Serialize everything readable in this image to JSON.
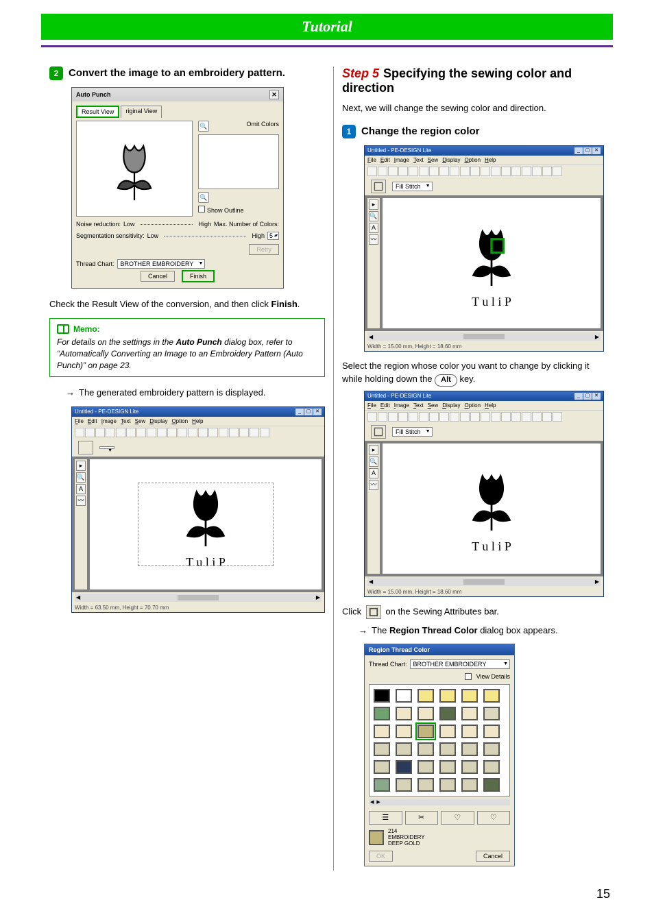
{
  "banner": "Tutorial",
  "page_number": "15",
  "left": {
    "badge2": "2",
    "step2_text": "Convert the image to an embroidery pattern.",
    "autopunch": {
      "title": "Auto Punch",
      "tab_result": "Result View",
      "tab_original": "riginal View",
      "omit_colors": "Omit Colors",
      "show_outline": "Show Outline",
      "noise_reduction": "Noise reduction:",
      "seg_sensitivity": "Segmentation sensitivity:",
      "low": "Low",
      "high": "High",
      "max_colors": "Max. Number of Colors:",
      "max_colors_val": "5",
      "retry": "Retry",
      "thread_chart": "Thread Chart:",
      "thread_chart_val": "BROTHER EMBROIDERY",
      "cancel": "Cancel",
      "finish": "Finish"
    },
    "after_dlg": "Check the Result View of the conversion, and then click ",
    "after_dlg_bold": "Finish",
    "after_dlg_end": ".",
    "memo_title": "Memo:",
    "memo_body_1": "For details on the settings in the ",
    "memo_body_bold": "Auto Punch",
    "memo_body_2": " dialog box, refer to “Automatically Converting an Image to an Embroidery Pattern (Auto Punch)” on page 23.",
    "arrow_text": "The generated embroidery pattern is displayed.",
    "app": {
      "title": "Untitled - PE-DESIGN Lite",
      "menus": [
        "File",
        "Edit",
        "Image",
        "Text",
        "Sew",
        "Display",
        "Option",
        "Help"
      ],
      "status": "Width = 63.50 mm, Height = 70.70 mm"
    }
  },
  "right": {
    "step5_red": "Step 5",
    "step5_black": "Specifying the sewing color and direction",
    "intro": "Next, we will change the sewing color and direction.",
    "badge1": "1",
    "substep1": "Change the region color",
    "app1_attrbar": "Fill Stitch",
    "app1_status": "Width = 15.00 mm, Height = 18.60 mm",
    "app2_attrbar": "Fill Stitch",
    "app2_status": "Width = 15.00 mm, Height = 18.60 mm",
    "select_region": "Select the region whose color you want to change by clicking it while holding down the ",
    "alt_key": "Alt",
    "select_region_end": " key.",
    "click_text_1": "Click ",
    "click_text_2": " on the Sewing Attributes bar.",
    "arrow2_a": "The ",
    "arrow2_bold": "Region Thread Color",
    "arrow2_b": " dialog box appears.",
    "rtc": {
      "title": "Region Thread Color",
      "thread_chart": "Thread Chart:",
      "thread_chart_val": "BROTHER EMBROIDERY",
      "view_details": "View Details",
      "code": "214",
      "name1": "EMBROIDERY",
      "name2": "DEEP GOLD",
      "ok": "OK",
      "cancel": "Cancel"
    },
    "app": {
      "title": "Untitled - PE-DESIGN Lite",
      "menus": [
        "File",
        "Edit",
        "Image",
        "Text",
        "Sew",
        "Display",
        "Option",
        "Help"
      ]
    }
  },
  "chart_data": {
    "type": "table",
    "title": "Region Thread Color swatch palette (visible subset, colors approximate)",
    "columns": 6,
    "rows_visible": 6,
    "selected_index": 14,
    "swatches": [
      "#000000",
      "#ffffff",
      "#f6e58a",
      "#f6e58a",
      "#f6e58a",
      "#f6e58a",
      "#6fa26f",
      "#efe7c7",
      "#efe7c7",
      "#5a6b4a",
      "#efe7c7",
      "#dcd8c0",
      "#efe7c7",
      "#efe7c7",
      "#c2b77a",
      "#efe7c7",
      "#efe7c7",
      "#efe7c7",
      "#d7d3b8",
      "#d7d3b8",
      "#d7d3b8",
      "#d7d3b8",
      "#d7d3b8",
      "#d7d3b8",
      "#d7d3b8",
      "#2b3a5a",
      "#d7d3b8",
      "#d7d3b8",
      "#d7d3b8",
      "#d7d3b8",
      "#8aa88a",
      "#d7d3b8",
      "#d7d3b8",
      "#d7d3b8",
      "#d7d3b8",
      "#5a6b4a"
    ]
  }
}
